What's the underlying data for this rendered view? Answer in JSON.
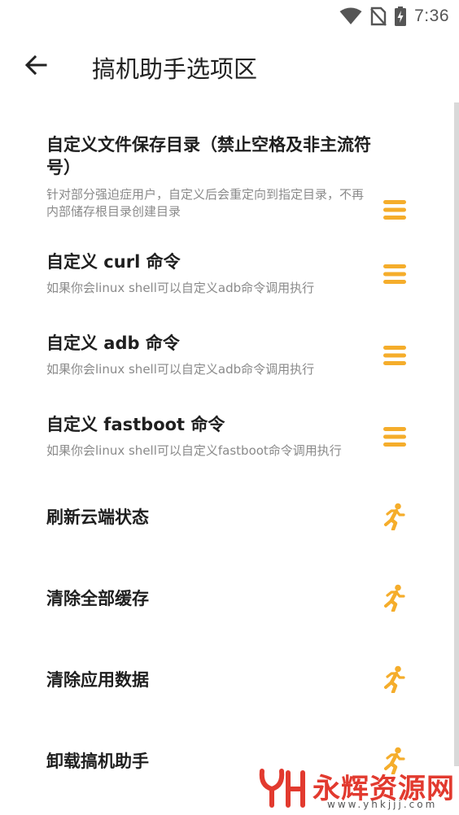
{
  "status_bar": {
    "time": "7:36",
    "icons": [
      "wifi-icon",
      "no-sim-icon",
      "battery-charging-icon"
    ]
  },
  "header": {
    "back_icon": "arrow-left-icon",
    "title": "搞机助手选项区"
  },
  "colors": {
    "accent": "#f5ad2b",
    "title_text": "#1f1f1f",
    "subtitle_text": "#8a8a8a",
    "scrollbar": "#d9d9d9",
    "watermark": "#e23a2f"
  },
  "items": [
    {
      "title": "自定义文件保存目录（禁止空格及非主流符号）",
      "subtitle": "针对部分强迫症用户，自定义后会重定向到指定目录，不再内部储存根目录创建目录",
      "icon": "menu-icon"
    },
    {
      "title": "自定义 curl 命令",
      "subtitle": "如果你会linux shell可以自定义adb命令调用执行",
      "icon": "menu-icon"
    },
    {
      "title": "自定义 adb 命令",
      "subtitle": "如果你会linux shell可以自定义adb命令调用执行",
      "icon": "menu-icon"
    },
    {
      "title": "自定义 fastboot 命令",
      "subtitle": "如果你会linux shell可以自定义fastboot命令调用执行",
      "icon": "menu-icon"
    },
    {
      "title": "刷新云端状态",
      "subtitle": "",
      "icon": "running-person-icon"
    },
    {
      "title": "清除全部缓存",
      "subtitle": "",
      "icon": "running-person-icon"
    },
    {
      "title": "清除应用数据",
      "subtitle": "",
      "icon": "running-person-icon"
    },
    {
      "title": "卸载搞机助手",
      "subtitle": "",
      "icon": "running-person-icon"
    }
  ],
  "watermark": {
    "logo": "YH",
    "text": "永辉资源网",
    "url": "www.yhkjjj.com"
  }
}
